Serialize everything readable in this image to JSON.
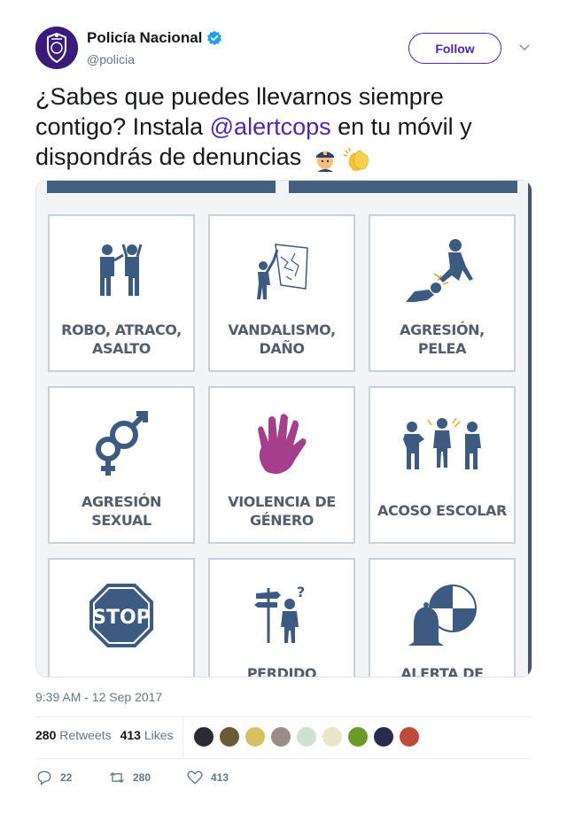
{
  "author": {
    "display_name": "Policía Nacional",
    "handle": "@policia",
    "verified_icon": "verified-badge-icon",
    "follow_label": "Follow"
  },
  "tweet": {
    "text_part1": "¿Sabes que puedes llevarnos siempre contigo? Instala ",
    "mention": "@alertcops",
    "text_part2": " en tu móvil y dispondrás de denuncias ",
    "emojis": [
      "police-officer-emoji",
      "clapping-hands-emoji"
    ]
  },
  "media": {
    "tiles": [
      {
        "label": "ROBO, ATRACO, ASALTO",
        "icon": "robbery-icon"
      },
      {
        "label": "VANDALISMO, DAÑO",
        "icon": "vandalism-icon"
      },
      {
        "label": "AGRESIÓN, PELEA",
        "icon": "fight-icon"
      },
      {
        "label": "AGRESIÓN SEXUAL",
        "icon": "gender-symbols-icon"
      },
      {
        "label": "VIOLENCIA DE GÉNERO",
        "icon": "handprint-icon"
      },
      {
        "label": "ACOSO ESCOLAR",
        "icon": "bullying-icon"
      },
      {
        "label": "",
        "icon": "stop-sign-icon",
        "sign_text": "STOP"
      },
      {
        "label": "PERDIDO",
        "icon": "lost-person-icon"
      },
      {
        "label": "ALERTA DE",
        "icon": "bell-alert-icon"
      }
    ],
    "colors": {
      "icon_blue": "#3d5a80",
      "violence_purple": "#9c2a7e",
      "label_gray": "#545e6a"
    }
  },
  "timestamp": "9:39 AM - 12 Sep 2017",
  "stats": {
    "retweets_count": "280",
    "retweets_label": "Retweets",
    "likes_count": "413",
    "likes_label": "Likes"
  },
  "actions": {
    "reply_count": "22",
    "retweet_count": "280",
    "like_count": "413"
  },
  "colors": {
    "accent": "#4b26b8",
    "muted": "#657786",
    "verified": "#1da1f2"
  }
}
